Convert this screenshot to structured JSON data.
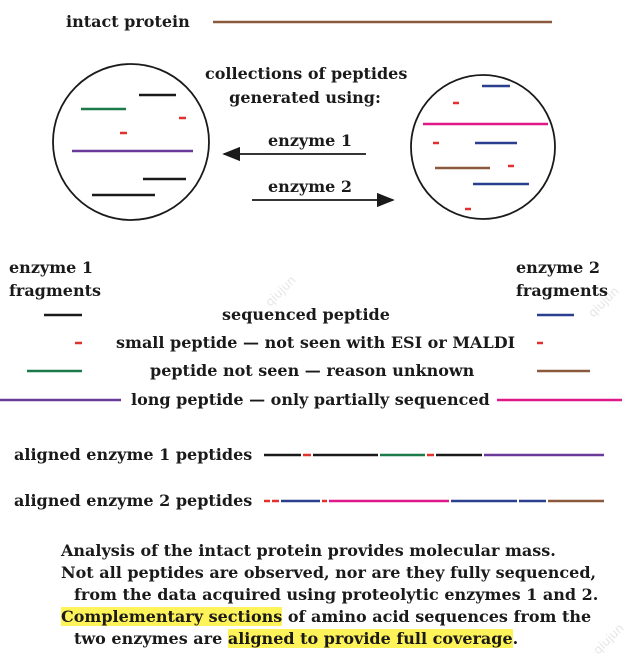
{
  "labels": {
    "intact_protein": "intact protein",
    "collections_line1": "collections of peptides",
    "collections_line2": "generated using:",
    "enzyme1": "enzyme 1",
    "enzyme2": "enzyme 2",
    "enzyme1_fragments_line1": "enzyme 1",
    "enzyme1_fragments_line2": "fragments",
    "enzyme2_fragments_line1": "enzyme 2",
    "enzyme2_fragments_line2": "fragments",
    "aligned1": "aligned enzyme 1 peptides",
    "aligned2": "aligned enzyme 2 peptides"
  },
  "legend": [
    {
      "text": "sequenced peptide"
    },
    {
      "text": "small peptide — not seen with ESI or MALDI"
    },
    {
      "text": "peptide not seen — reason unknown"
    },
    {
      "text": "long peptide — only partially sequenced"
    }
  ],
  "caption": {
    "line1": "Analysis of the intact protein provides molecular mass.",
    "line2": "Not all peptides are observed, nor are they fully sequenced,",
    "line3": "from the data acquired using proteolytic enzymes 1 and 2.",
    "line4_highlight": "Complementary sections",
    "line4_rest": " of amino acid sequences from the",
    "line5_start": "two enzymes are ",
    "line5_highlight": "aligned to provide full coverage",
    "line5_end": "."
  },
  "watermark": "qiujun",
  "colors": {
    "protein": "#8b5a3c",
    "sequenced1": "#1a1a1a",
    "sequenced2": "#2b3f8f",
    "small": "#e0312f",
    "not_seen": "#1c7a4a",
    "long1": "#6a3a9a",
    "long2": "#e0198a",
    "not_seen2": "#8b5a3c",
    "highlight": "#fff35a"
  }
}
